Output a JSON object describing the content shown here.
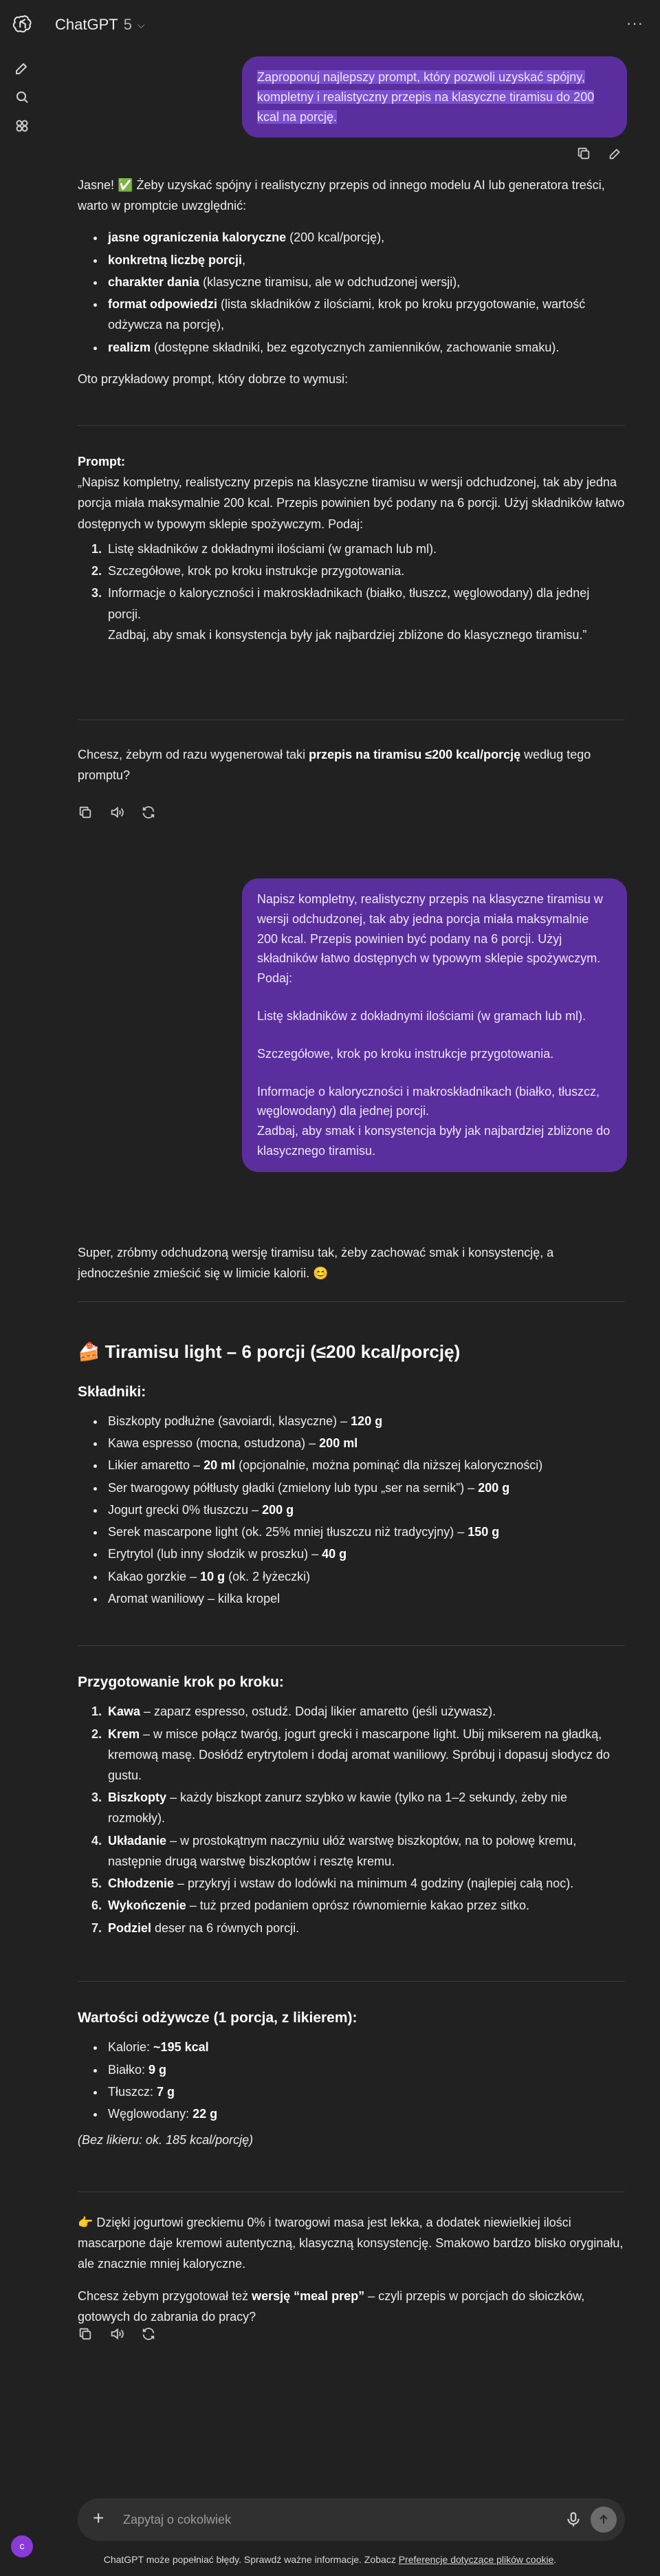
{
  "header": {
    "model_name": "ChatGPT",
    "model_version": "5"
  },
  "icons": {
    "logo": "openai-logo-icon",
    "new_chat": "edit-icon",
    "search": "search-icon",
    "library": "library-icon",
    "more": "more-icon",
    "copy": "copy-icon",
    "edit": "pencil-icon",
    "speaker": "speaker-icon",
    "regenerate": "refresh-icon",
    "mic": "microphone-icon",
    "send": "arrow-up-icon"
  },
  "user_message_1": "Zaproponuj najlepszy prompt, który pozwoli uzyskać spójny, kompletny i realistyczny przepis na klasyczne tiramisu do 200 kcal na porcję.",
  "assistant_1": {
    "intro": "Jasne! ✅ Żeby uzyskać spójny i realistyczny przepis od innego modelu AI lub generatora treści, warto w promptcie uwzględnić:",
    "bullets": [
      {
        "bold": "jasne ograniczenia kaloryczne",
        "rest": " (200 kcal/porcję),"
      },
      {
        "bold": "konkretną liczbę porcji",
        "rest": ","
      },
      {
        "bold": "charakter dania",
        "rest": " (klasyczne tiramisu, ale w odchudzonej wersji),"
      },
      {
        "bold": "format odpowiedzi",
        "rest": " (lista składników z ilościami, krok po kroku przygotowanie, wartość odżywcza na porcję),"
      },
      {
        "bold": "realizm",
        "rest": " (dostępne składniki, bez egzotycznych zamienników, zachowanie smaku)."
      }
    ],
    "outro": "Oto przykładowy prompt, który dobrze to wymusi:",
    "prompt_label": "Prompt:",
    "prompt_text": "„Napisz kompletny, realistyczny przepis na klasyczne tiramisu w wersji odchudzonej, tak aby jedna porcja miała maksymalnie 200 kcal. Przepis powinien być podany na 6 porcji. Użyj składników łatwo dostępnych w typowym sklepie spożywczym. Podaj:",
    "prompt_items": [
      "Listę składników z dokładnymi ilościami (w gramach lub ml).",
      "Szczegółowe, krok po kroku instrukcje przygotowania.",
      "Informacje o kaloryczności i makroskładnikach (białko, tłuszcz, węglowodany) dla jednej porcji."
    ],
    "prompt_tail": "Zadbaj, aby smak i konsystencja były jak najbardziej zbliżone do klasycznego tiramisu.”",
    "question_pre": "Chcesz, żebym od razu wygenerował taki ",
    "question_bold": "przepis na tiramisu ≤200 kcal/porcję",
    "question_post": " według tego promptu?"
  },
  "user_message_2": {
    "p1": "Napisz kompletny, realistyczny przepis na klasyczne tiramisu w wersji odchudzonej, tak aby jedna porcja miała maksymalnie 200 kcal. Przepis powinien być podany na 6 porcji. Użyj składników łatwo dostępnych w typowym sklepie spożywczym. Podaj:",
    "p2": "Listę składników z dokładnymi ilościami (w gramach lub ml).",
    "p3": "Szczegółowe, krok po kroku instrukcje przygotowania.",
    "p4a": "Informacje o kaloryczności i makroskładnikach (białko, tłuszcz, węglowodany) dla jednej porcji.",
    "p4b": "Zadbaj, aby smak i konsystencja były jak najbardziej zbliżone do klasycznego tiramisu."
  },
  "assistant_2": {
    "intro": "Super, zróbmy odchudzoną wersję tiramisu tak, żeby zachować smak i konsystencję, a jednocześnie zmieścić się w limicie kalorii. 😊",
    "title": "🍰 Tiramisu light – 6 porcji (≤200 kcal/porcję)",
    "ingredients_heading": "Składniki:",
    "ingredients": [
      {
        "text": "Biszkopty podłużne (savoiardi, klasyczne) – ",
        "bold": "120 g",
        "after": ""
      },
      {
        "text": "Kawa espresso (mocna, ostudzona) – ",
        "bold": "200 ml",
        "after": ""
      },
      {
        "text": "Likier amaretto – ",
        "bold": "20 ml",
        "after": " (opcjonalnie, można pominąć dla niższej kaloryczności)"
      },
      {
        "text": "Ser twarogowy półtłusty gładki (zmielony lub typu „ser na sernik”) – ",
        "bold": "200 g",
        "after": ""
      },
      {
        "text": "Jogurt grecki 0% tłuszczu – ",
        "bold": "200 g",
        "after": ""
      },
      {
        "text": "Serek mascarpone light (ok. 25% mniej tłuszczu niż tradycyjny) – ",
        "bold": "150 g",
        "after": ""
      },
      {
        "text": "Erytrytol (lub inny słodzik w proszku) – ",
        "bold": "40 g",
        "after": ""
      },
      {
        "text": "Kakao gorzkie – ",
        "bold": "10 g",
        "after": " (ok. 2 łyżeczki)"
      },
      {
        "text": "Aromat waniliowy – kilka kropel",
        "bold": "",
        "after": ""
      }
    ],
    "steps_heading": "Przygotowanie krok po kroku:",
    "steps": [
      {
        "bold": "Kawa",
        "rest": " – zaparz espresso, ostudź. Dodaj likier amaretto (jeśli używasz)."
      },
      {
        "bold": "Krem",
        "rest": " – w misce połącz twaróg, jogurt grecki i mascarpone light. Ubij mikserem na gładką, kremową masę. Dosłódź erytrytolem i dodaj aromat waniliowy. Spróbuj i dopasuj słodycz do gustu."
      },
      {
        "bold": "Biszkopty",
        "rest": " – każdy biszkopt zanurz szybko w kawie (tylko na 1–2 sekundy, żeby nie rozmokły)."
      },
      {
        "bold": "Układanie",
        "rest": " – w prostokątnym naczyniu ułóż warstwę biszkoptów, na to połowę kremu, następnie drugą warstwę biszkoptów i resztę kremu."
      },
      {
        "bold": "Chłodzenie",
        "rest": " – przykryj i wstaw do lodówki na minimum 4 godziny (najlepiej całą noc)."
      },
      {
        "bold": "Wykończenie",
        "rest": " – tuż przed podaniem oprósz równomiernie kakao przez sitko."
      },
      {
        "bold": "Podziel",
        "rest": " deser na 6 równych porcji."
      }
    ],
    "nutrition_heading": "Wartości odżywcze (1 porcja, z likierem):",
    "nutrition": [
      {
        "label": "Kalorie: ",
        "value": "~195 kcal"
      },
      {
        "label": "Białko: ",
        "value": "9 g"
      },
      {
        "label": "Tłuszcz: ",
        "value": "7 g"
      },
      {
        "label": "Węglowodany: ",
        "value": "22 g"
      }
    ],
    "nutrition_note": "(Bez likieru: ok. 185 kcal/porcję)",
    "closing": "👉 Dzięki jogurtowi greckiemu 0% i twarogowi masa jest lekka, a dodatek niewielkiej ilości mascarpone daje kremowi autentyczną, klasyczną konsystencję. Smakowo bardzo blisko oryginału, ale znacznie mniej kaloryczne.",
    "question_pre": "Chcesz żebym przygotował też ",
    "question_bold": "wersję “meal prep”",
    "question_post": " – czyli przepis w porcjach do słoiczków, gotowych do zabrania do pracy?"
  },
  "composer": {
    "placeholder": "Zapytaj o cokolwiek"
  },
  "footer": {
    "text": "ChatGPT może popełniać błędy. Sprawdź ważne informacje. Zobacz ",
    "link": "Preferencje dotyczące plików cookie",
    "end": "."
  },
  "user_avatar_initial": "c"
}
